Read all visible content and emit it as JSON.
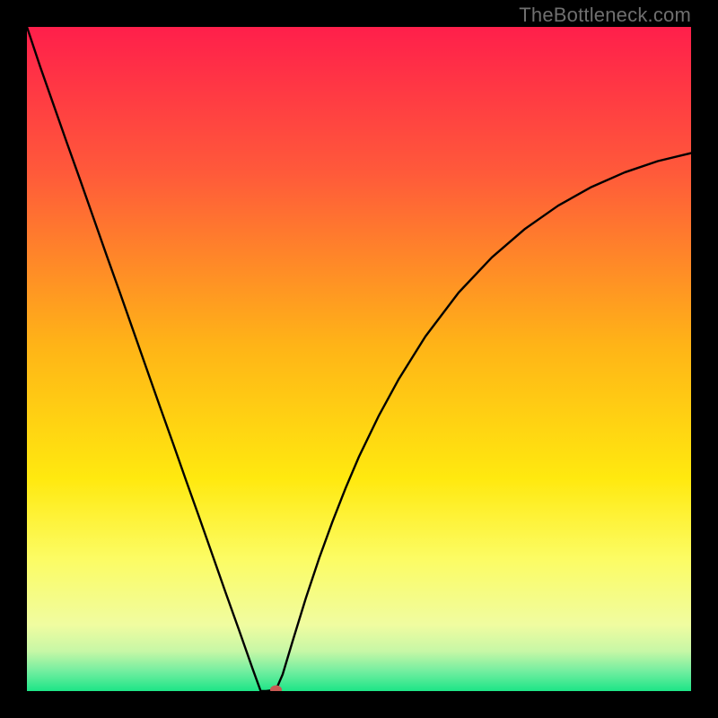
{
  "watermark": "TheBottleneck.com",
  "chart_data": {
    "type": "line",
    "title": "",
    "xlabel": "",
    "ylabel": "",
    "xlim": [
      0,
      100
    ],
    "ylim": [
      0,
      100
    ],
    "grid": false,
    "legend": false,
    "series": [
      {
        "name": "bottleneck-curve",
        "x": [
          0,
          2,
          4,
          6,
          8,
          10,
          12,
          14,
          16,
          18,
          20,
          22,
          24,
          26,
          28,
          30,
          32,
          34,
          35.2,
          36,
          37.5,
          38.5,
          40,
          42,
          44,
          46,
          48,
          50,
          53,
          56,
          60,
          65,
          70,
          75,
          80,
          85,
          90,
          95,
          100
        ],
        "values": [
          100,
          94,
          88.3,
          82.6,
          77,
          71.3,
          65.6,
          60,
          54.3,
          48.6,
          42.9,
          37.3,
          31.6,
          26,
          20.3,
          14.6,
          9,
          3.3,
          0,
          0,
          0.2,
          2.5,
          7.5,
          14,
          20,
          25.5,
          30.6,
          35.3,
          41.5,
          47,
          53.4,
          60,
          65.3,
          69.6,
          73.1,
          75.9,
          78.1,
          79.8,
          81
        ]
      }
    ],
    "marker": {
      "x": 37.5,
      "y": 0.2,
      "color": "#c85a54"
    },
    "background_gradient": {
      "stops": [
        {
          "pct": 0,
          "color": "#ff1f4b"
        },
        {
          "pct": 22,
          "color": "#ff5a3a"
        },
        {
          "pct": 48,
          "color": "#ffb417"
        },
        {
          "pct": 68,
          "color": "#ffe90f"
        },
        {
          "pct": 80,
          "color": "#fcfc63"
        },
        {
          "pct": 90,
          "color": "#f0fca0"
        },
        {
          "pct": 94,
          "color": "#c7f7a6"
        },
        {
          "pct": 97,
          "color": "#73eea0"
        },
        {
          "pct": 100,
          "color": "#1de587"
        }
      ]
    }
  }
}
